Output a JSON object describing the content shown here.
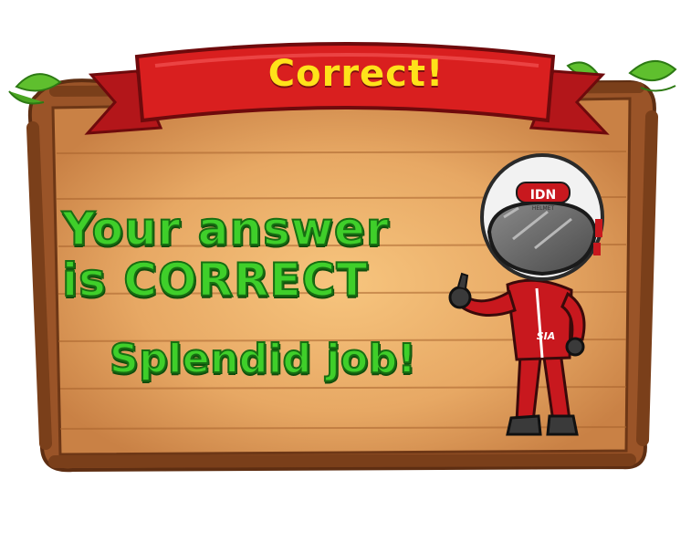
{
  "banner": {
    "title": "Correct!"
  },
  "message": {
    "line1": "Your answer",
    "line2": "is CORRECT",
    "line3": "Splendid job!"
  },
  "mascot": {
    "helmet_brand": "IDN",
    "helmet_sub": "HELMET",
    "suit_badge": "SIA"
  },
  "colors": {
    "wood": "#c77f45",
    "wood_frame": "#8a4a22",
    "board_center": "#f5be78",
    "banner": "#d91f1f",
    "banner_text": "#ffe21a",
    "message_green": "#3fcf2a",
    "leaf": "#5fbf2e",
    "suit_red": "#c8181e"
  },
  "icons": [
    "leaf-icon",
    "ribbon-banner",
    "racer-mascot"
  ]
}
